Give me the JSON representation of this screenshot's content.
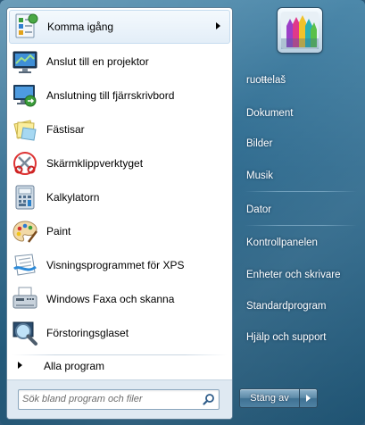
{
  "programs": [
    {
      "label": "Komma igång",
      "icon": "getting-started-icon",
      "has_submenu": true
    },
    {
      "label": "Anslut till en projektor",
      "icon": "projector-icon",
      "has_submenu": false
    },
    {
      "label": "Anslutning till fjärrskrivbord",
      "icon": "remote-desktop-icon",
      "has_submenu": false
    },
    {
      "label": "Fästisar",
      "icon": "sticky-notes-icon",
      "has_submenu": false
    },
    {
      "label": "Skärmklippverktyget",
      "icon": "snipping-tool-icon",
      "has_submenu": false
    },
    {
      "label": "Kalkylatorn",
      "icon": "calculator-icon",
      "has_submenu": false
    },
    {
      "label": "Paint",
      "icon": "paint-icon",
      "has_submenu": false
    },
    {
      "label": "Visningsprogrammet för XPS",
      "icon": "xps-viewer-icon",
      "has_submenu": false
    },
    {
      "label": "Windows Faxa och skanna",
      "icon": "fax-scan-icon",
      "has_submenu": false
    },
    {
      "label": "Förstoringsglaset",
      "icon": "magnifier-icon",
      "has_submenu": false
    }
  ],
  "all_programs_label": "Alla program",
  "search": {
    "placeholder": "Sök bland program och filer"
  },
  "user": {
    "picture_icon": "crayons-icon"
  },
  "right_links": [
    {
      "label": "ruoŧŧelaš"
    },
    {
      "label": "Dokument"
    },
    {
      "label": "Bilder"
    },
    {
      "label": "Musik"
    },
    {
      "label": "Dator"
    },
    {
      "label": "Kontrollpanelen"
    },
    {
      "label": "Enheter och skrivare"
    },
    {
      "label": "Standardprogram"
    },
    {
      "label": "Hjälp och support"
    }
  ],
  "shutdown": {
    "label": "Stäng av"
  },
  "colors": {
    "frame": "#2e6a8e",
    "left_pane": "#ffffff",
    "search_area": "#dfe9f2"
  }
}
